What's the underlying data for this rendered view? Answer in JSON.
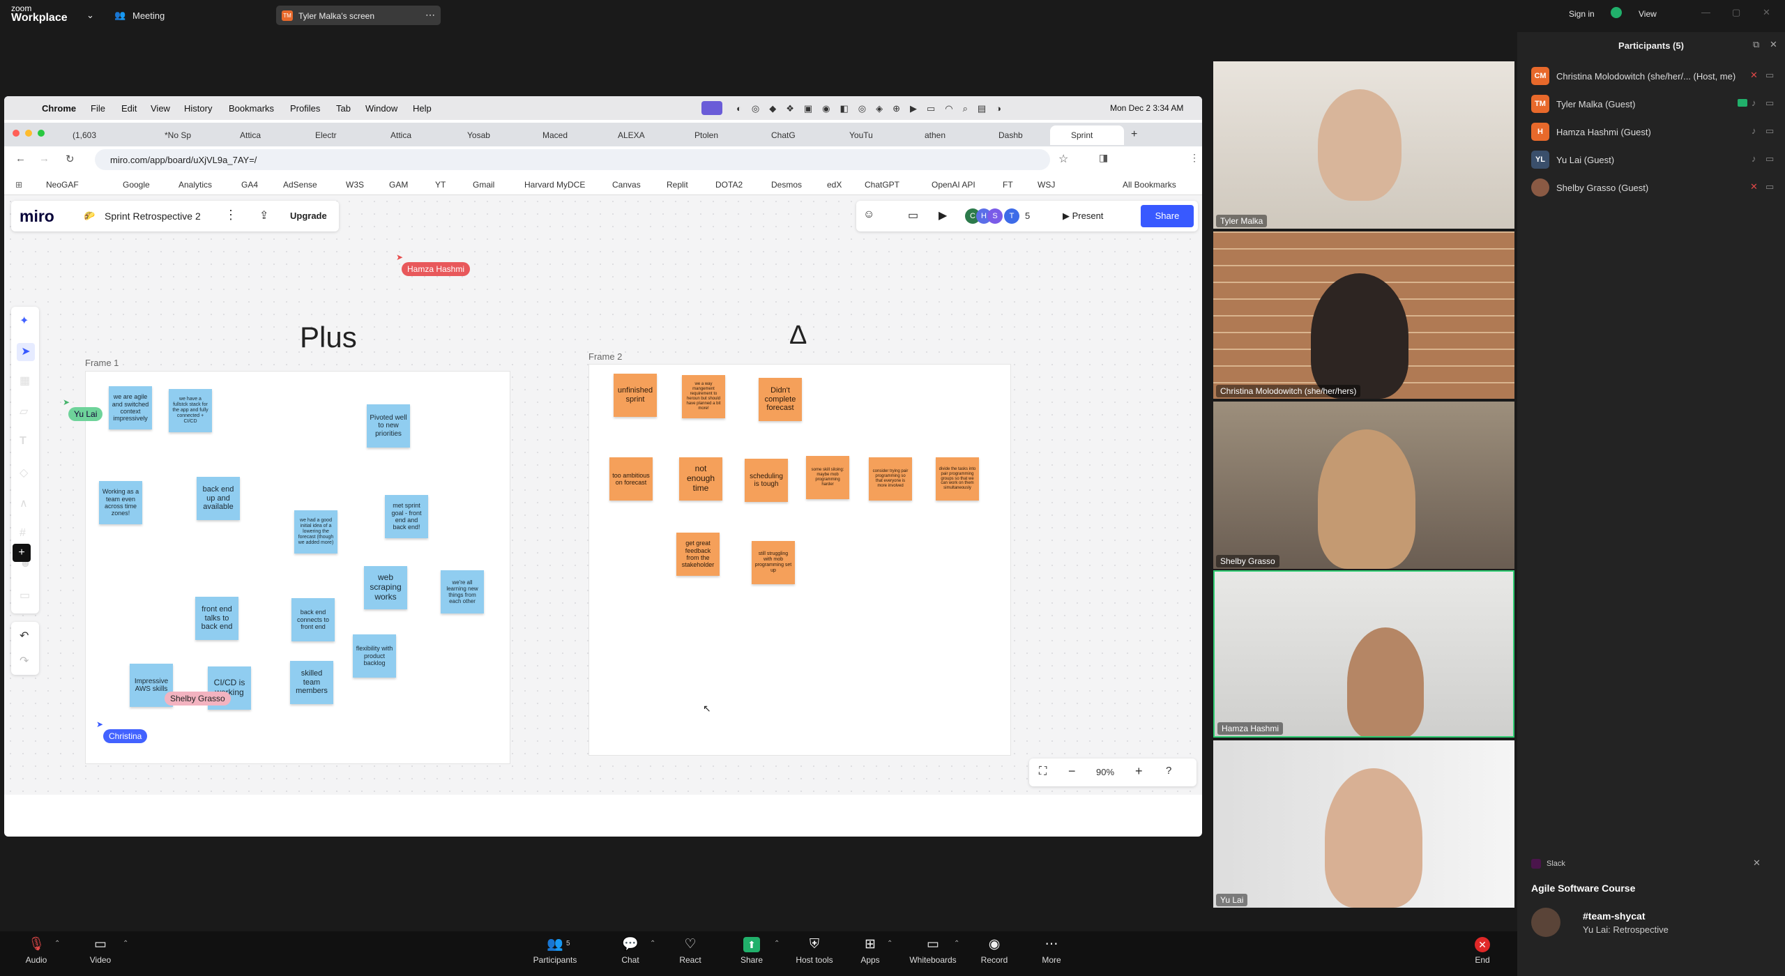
{
  "zoom": {
    "brand_top": "zoom",
    "brand_name": "Workplace",
    "meeting_label": "Meeting",
    "share_chip": "Tyler Malka's screen",
    "share_chip_initials": "TM",
    "sign_in": "Sign in",
    "view": "View"
  },
  "mac": {
    "menu": [
      "Chrome",
      "File",
      "Edit",
      "View",
      "History",
      "Bookmarks",
      "Profiles",
      "Tab",
      "Window",
      "Help"
    ],
    "clock": "Mon Dec 2  3:34 AM"
  },
  "browser": {
    "tabs": [
      "(1,603",
      "*No Sp",
      "Attica",
      "Electr",
      "Attica",
      "Yosab",
      "Maced",
      "ALEXA",
      "Ptolen",
      "ChatG",
      "YouTu",
      "athen",
      "Dashb",
      "Sprint"
    ],
    "url": "miro.com/app/board/uXjVL9a_7AY=/",
    "bookmarks": [
      "NeoGAF",
      "Google",
      "Analytics",
      "GA4",
      "AdSense",
      "W3S",
      "GAM",
      "YT",
      "Gmail",
      "Harvard MyDCE",
      "Canvas",
      "Replit",
      "DOTA2",
      "Desmos",
      "edX",
      "ChatGPT",
      "OpenAI API",
      "FT",
      "WSJ"
    ],
    "all_bookmarks": "All Bookmarks"
  },
  "miro": {
    "logo": "miro",
    "board_title": "Sprint Retrospective 2",
    "upgrade": "Upgrade",
    "present": "Present",
    "share": "Share",
    "collab_count": "5",
    "zoom_level": "90%",
    "frame1_label": "Frame 1",
    "frame2_label": "Frame 2",
    "plus_heading": "Plus",
    "delta_heading": "Δ",
    "plus_notes": [
      "we are agile and switched context impressively",
      "we have a fullstck stack for the app and fully connected + CI/CD",
      "Pivoted well to new priorities",
      "Working as a team even across time zones!",
      "back end up and available",
      "we had a good initial idea of a lowering the forecast (though we added more)",
      "met sprint goal - front end and back end!",
      "web scraping works",
      "we're all learning new things from each other",
      "front end talks to back end",
      "back end connects to front end",
      "flexibility with product backlog",
      "Impressive AWS skills",
      "CI/CD is working",
      "skilled team members"
    ],
    "delta_notes": [
      "unfinished sprint",
      "we a way mangement requirement to heroun but should have planned a bit more!",
      "Didn't complete forecast",
      "too ambitious on forecast",
      "not enough time",
      "scheduling is tough",
      "some skill siloing: maybe mob programming harder",
      "consider trying pair programming so that everyone is more involved",
      "divide the tasks into pair programming groups so that we can work on them simultaneously",
      "get great feedback from the stakeholder",
      "still struggling with mob programming set up"
    ],
    "cursors": [
      "Hamza Hashmi",
      "Yu Lai",
      "Shelby Grasso",
      "Christina"
    ]
  },
  "videos": [
    {
      "name": "Tyler Malka"
    },
    {
      "name": "Christina Molodowitch (she/her/hers)"
    },
    {
      "name": "Shelby Grasso"
    },
    {
      "name": "Hamza Hashmi"
    },
    {
      "name": "Yu Lai"
    }
  ],
  "participants": {
    "title": "Participants (5)",
    "list": [
      {
        "initials": "CM",
        "name": "Christina Molodowitch (she/her/... (Host, me)",
        "color": "#e8692b"
      },
      {
        "initials": "TM",
        "name": "Tyler Malka (Guest)",
        "color": "#e8692b"
      },
      {
        "initials": "H",
        "name": "Hamza Hashmi (Guest)",
        "color": "#e8692b"
      },
      {
        "initials": "YL",
        "name": "Yu Lai (Guest)",
        "color": "#3a4f6b"
      },
      {
        "initials": "",
        "name": "Shelby Grasso (Guest)",
        "color": "#8a5a44"
      }
    ]
  },
  "slack": {
    "app": "Slack",
    "workspace": "Agile Software Course",
    "channel": "#team-shycat",
    "message": "Yu Lai: Retrospective"
  },
  "toolbar": {
    "audio": "Audio",
    "video": "Video",
    "participants": "Participants",
    "participants_count": "5",
    "chat": "Chat",
    "react": "React",
    "share": "Share",
    "host_tools": "Host tools",
    "apps": "Apps",
    "whiteboards": "Whiteboards",
    "record": "Record",
    "more": "More",
    "end": "End"
  }
}
